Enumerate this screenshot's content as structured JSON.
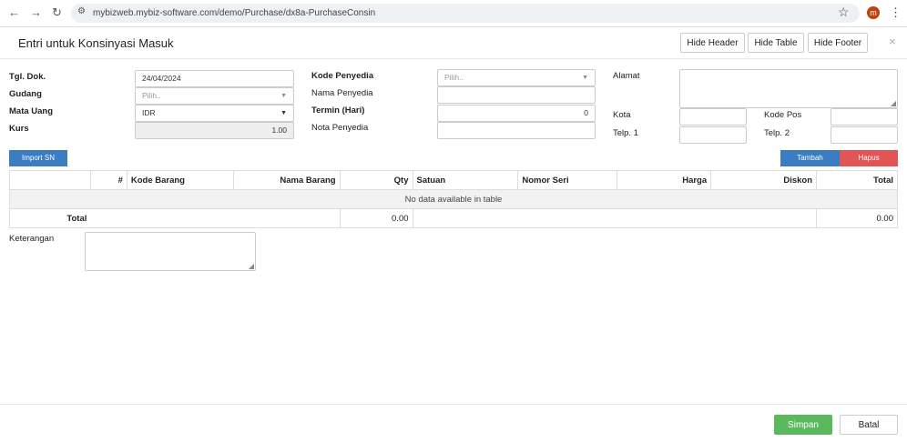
{
  "browser": {
    "url": "mybizweb.mybiz-software.com/demo/Purchase/dx8a-PurchaseConsin",
    "avatar_letter": "m"
  },
  "dialog": {
    "title": "Entri untuk Konsinyasi Masuk",
    "hide_header": "Hide Header",
    "hide_table": "Hide Table",
    "hide_footer": "Hide Footer",
    "close": "×"
  },
  "form": {
    "tgl_dok_label": "Tgl. Dok.",
    "tgl_dok_value": "24/04/2024",
    "gudang_label": "Gudang",
    "gudang_placeholder": "Pilih..",
    "mata_uang_label": "Mata Uang",
    "mata_uang_value": "IDR",
    "kurs_label": "Kurs",
    "kurs_value": "1.00",
    "kode_penyedia_label": "Kode Penyedia",
    "kode_penyedia_placeholder": "Pilih..",
    "nama_penyedia_label": "Nama Penyedia",
    "termin_label": "Termin (Hari)",
    "termin_value": "0",
    "nota_penyedia_label": "Nota Penyedia",
    "alamat_label": "Alamat",
    "kota_label": "Kota",
    "kode_pos_label": "Kode Pos",
    "telp1_label": "Telp. 1",
    "telp2_label": "Telp. 2"
  },
  "actions": {
    "import_sn": "Import SN",
    "tambah": "Tambah",
    "hapus": "Hapus"
  },
  "table": {
    "columns": [
      "#",
      "Kode Barang",
      "Nama Barang",
      "Qty",
      "Satuan",
      "Nomor Seri",
      "Harga",
      "Diskon",
      "Total"
    ],
    "empty_text": "No data available in table",
    "total_label": "Total",
    "total_qty": "0.00",
    "total_amount": "0.00"
  },
  "footer_form": {
    "keterangan_label": "Keterangan"
  },
  "footer": {
    "simpan": "Simpan",
    "batal": "Batal"
  }
}
